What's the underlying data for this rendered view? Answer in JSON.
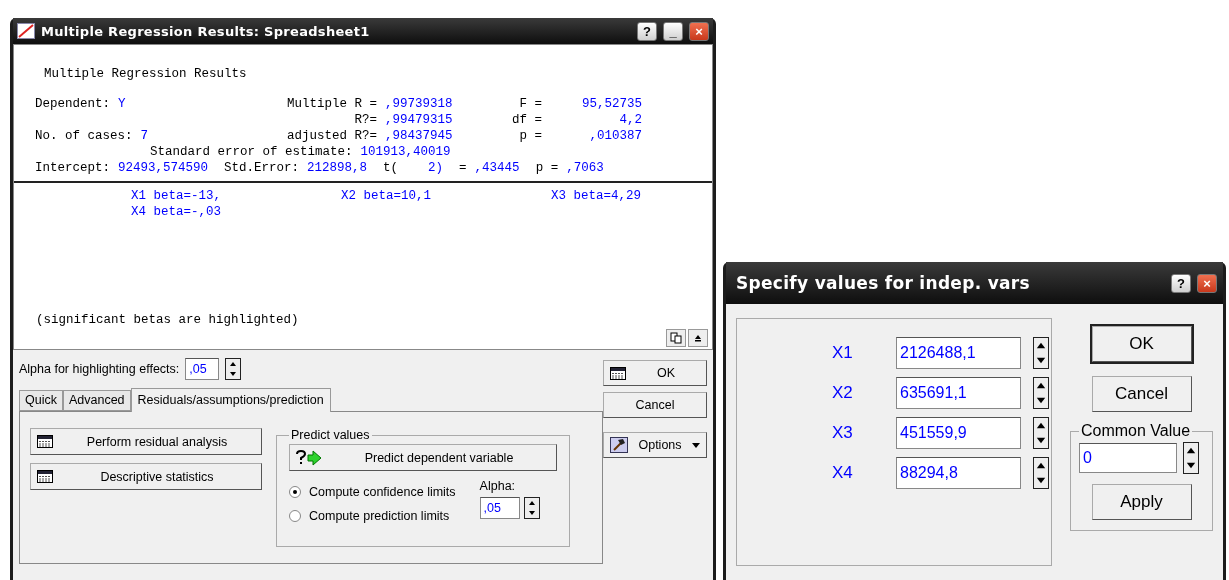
{
  "results_window": {
    "title": "Multiple Regression Results: Spreadsheet1",
    "title_buttons": [
      "?",
      "_",
      "×"
    ],
    "heading": "Multiple Regression Results",
    "stats": [
      {
        "c1_label": "Dependent:",
        "c1_value": "Y",
        "c2_label": "Multiple R =",
        "c2_value": ",99739318",
        "c3_label": "F =",
        "c3_value": "95,52735"
      },
      {
        "c2_label": "R?=",
        "c2_value": ",99479315",
        "c3_label": "df =",
        "c3_value": "4,2"
      },
      {
        "c1_label": "No. of cases:",
        "c1_value": "7",
        "c2_label": "adjusted R?=",
        "c2_value": ",98437945",
        "c3_label": "p =",
        "c3_value": ",010387"
      }
    ],
    "std_error": {
      "label": "Standard error of estimate:",
      "value": "101913,40019"
    },
    "intercept": [
      {
        "label": "Intercept:",
        "value": "92493,574590"
      },
      {
        "label": "Std.Error:",
        "value": "212898,8"
      },
      {
        "label": "t(",
        "value": "2)"
      },
      {
        "label": "=",
        "value": ",43445"
      },
      {
        "label": "p =",
        "value": ",7063"
      }
    ],
    "betas": [
      "X1 beta=-13,",
      "X2 beta=10,1",
      "X3 beta=4,29",
      "X4 beta=-,03"
    ],
    "note": "(significant betas are highlighted)",
    "alpha": {
      "label": "Alpha for highlighting effects:",
      "value": ",05"
    },
    "tabs": [
      {
        "label": "Quick",
        "selected": false
      },
      {
        "label": "Advanced",
        "selected": false
      },
      {
        "label": "Residuals/assumptions/prediction",
        "selected": true
      }
    ],
    "actions": [
      "Perform residual analysis",
      "Descriptive statistics"
    ],
    "predict": {
      "title": "Predict values",
      "button": "Predict dependent variable",
      "options": [
        {
          "label": "Compute confidence limits",
          "selected": true
        },
        {
          "label": "Compute prediction limits",
          "selected": false
        }
      ],
      "alpha_label": "Alpha:",
      "alpha_value": ",05"
    },
    "buttons": {
      "ok": "OK",
      "cancel": "Cancel",
      "options": "Options"
    }
  },
  "values_dialog": {
    "title": "Specify values for indep. vars",
    "title_buttons": [
      "?",
      "×"
    ],
    "vars": [
      {
        "name": "X1",
        "value": "2126488,1"
      },
      {
        "name": "X2",
        "value": "635691,1"
      },
      {
        "name": "X3",
        "value": "451559,9"
      },
      {
        "name": "X4",
        "value": "88294,8"
      }
    ],
    "ok": "OK",
    "cancel": "Cancel",
    "common": {
      "title": "Common Value",
      "value": "0",
      "apply": "Apply"
    }
  }
}
